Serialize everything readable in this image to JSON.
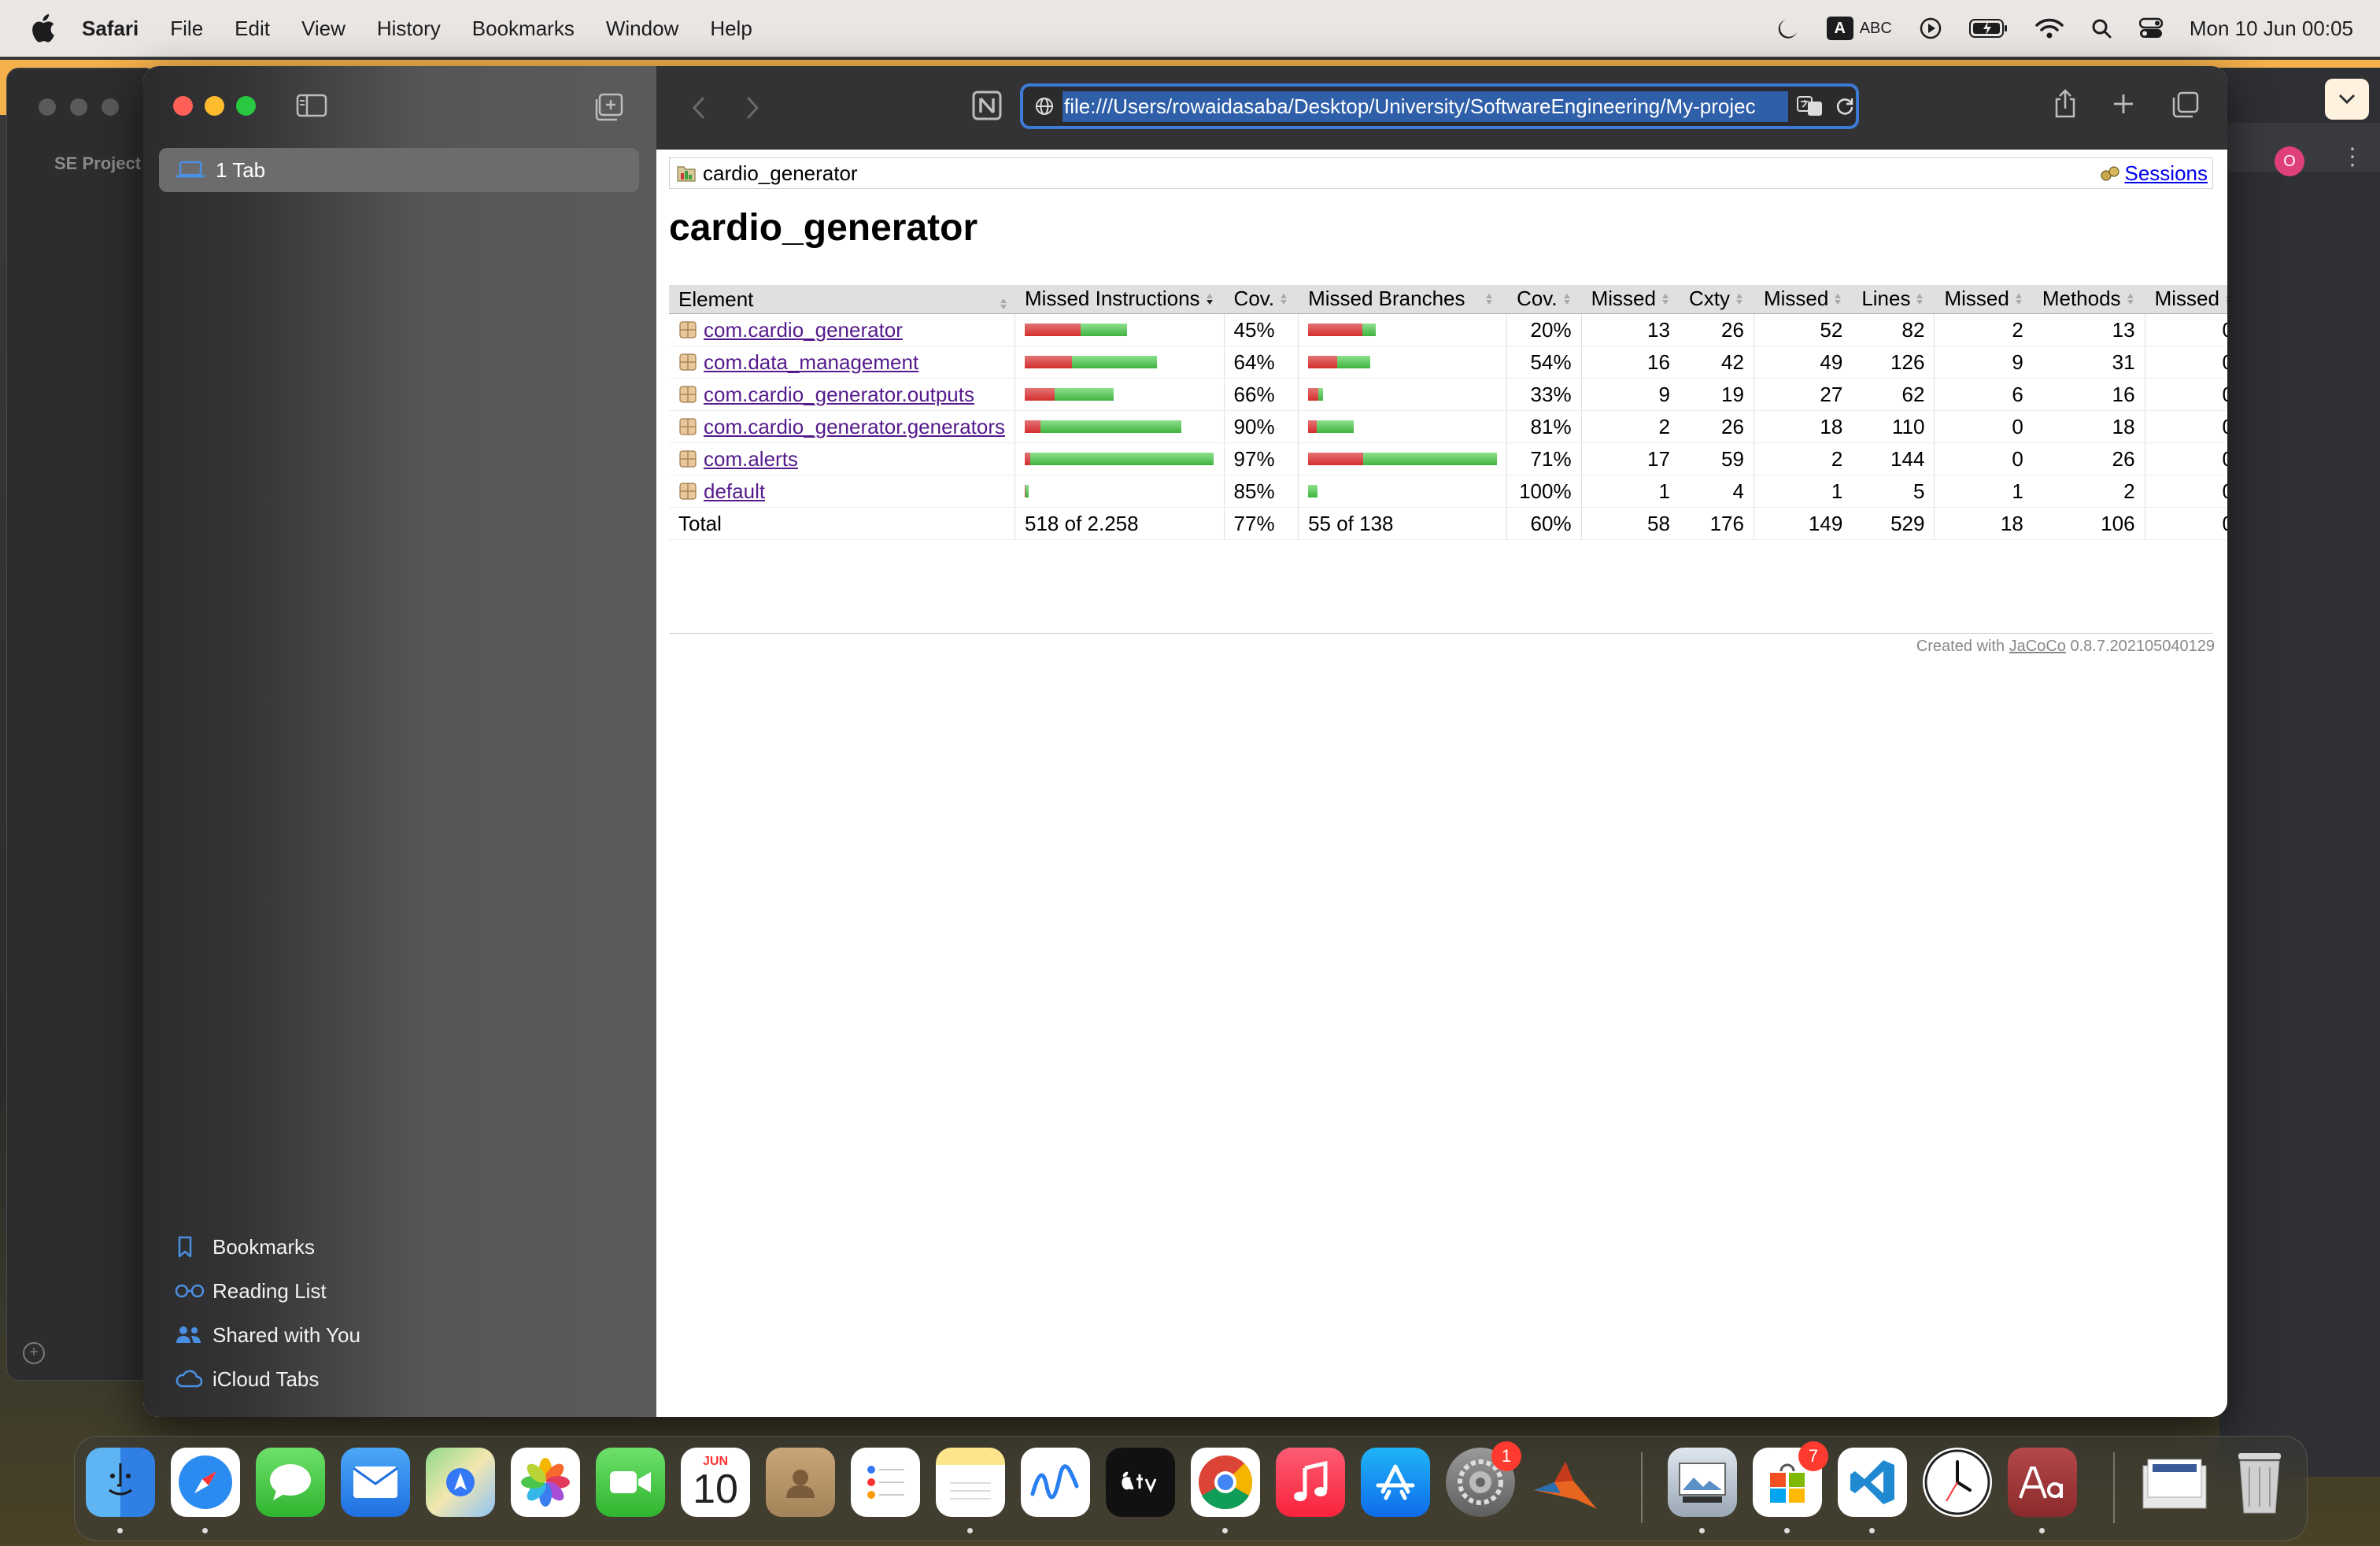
{
  "menubar": {
    "app_name": "Safari",
    "menus": [
      "File",
      "Edit",
      "View",
      "History",
      "Bookmarks",
      "Window",
      "Help"
    ],
    "input_source": "ABC",
    "input_source_letter": "A",
    "clock": "Mon 10 Jun  00:05"
  },
  "background_window": {
    "tab_title": "SE Project",
    "badge_text": "O"
  },
  "sidebar": {
    "tab_group_label": "1 Tab",
    "bottom_items": [
      {
        "label": "Bookmarks",
        "icon": "bookmark-icon"
      },
      {
        "label": "Reading List",
        "icon": "reading-list-icon"
      },
      {
        "label": "Shared with You",
        "icon": "shared-with-you-icon"
      },
      {
        "label": "iCloud Tabs",
        "icon": "icloud-icon"
      }
    ]
  },
  "toolbar": {
    "url": "file:///Users/rowaidasaba/Desktop/University/SoftwareEngineering/My-projec"
  },
  "page": {
    "breadcrumb": "cardio_generator",
    "sessions_link": "Sessions",
    "title": "cardio_generator",
    "columns": [
      "Element",
      "Missed Instructions",
      "Cov.",
      "Missed Branches",
      "Cov.",
      "Missed",
      "Cxty",
      "Missed",
      "Lines",
      "Missed",
      "Methods",
      "Missed"
    ],
    "rows": [
      {
        "name": "com.cardio_generator",
        "instr_cov": "45%",
        "instr_red": 0.55,
        "instr_green": 0.45,
        "instr_len": 0.54,
        "br_cov": "20%",
        "br_red": 0.8,
        "br_green": 0.2,
        "br_len": 0.36,
        "missed_cxty": "13",
        "cxty": "26",
        "missed_lines": "52",
        "lines": "82",
        "missed_methods": "2",
        "methods": "13",
        "missed_classes": "0"
      },
      {
        "name": "com.data_management",
        "instr_cov": "64%",
        "instr_red": 0.36,
        "instr_green": 0.64,
        "instr_len": 0.7,
        "br_cov": "54%",
        "br_red": 0.46,
        "br_green": 0.54,
        "br_len": 0.33,
        "missed_cxty": "16",
        "cxty": "42",
        "missed_lines": "49",
        "lines": "126",
        "missed_methods": "9",
        "methods": "31",
        "missed_classes": "0"
      },
      {
        "name": "com.cardio_generator.outputs",
        "instr_cov": "66%",
        "instr_red": 0.34,
        "instr_green": 0.66,
        "instr_len": 0.47,
        "br_cov": "33%",
        "br_red": 0.67,
        "br_green": 0.33,
        "br_len": 0.08,
        "missed_cxty": "9",
        "cxty": "19",
        "missed_lines": "27",
        "lines": "62",
        "missed_methods": "6",
        "methods": "16",
        "missed_classes": "0"
      },
      {
        "name": "com.cardio_generator.generators",
        "instr_cov": "90%",
        "instr_red": 0.1,
        "instr_green": 0.9,
        "instr_len": 0.83,
        "br_cov": "81%",
        "br_red": 0.19,
        "br_green": 0.81,
        "br_len": 0.24,
        "missed_cxty": "2",
        "cxty": "26",
        "missed_lines": "18",
        "lines": "110",
        "missed_methods": "0",
        "methods": "18",
        "missed_classes": "0"
      },
      {
        "name": "com.alerts",
        "instr_cov": "97%",
        "instr_red": 0.03,
        "instr_green": 0.97,
        "instr_len": 1.0,
        "br_cov": "71%",
        "br_red": 0.29,
        "br_green": 0.71,
        "br_len": 1.0,
        "missed_cxty": "17",
        "cxty": "59",
        "missed_lines": "2",
        "lines": "144",
        "missed_methods": "0",
        "methods": "26",
        "missed_classes": "0"
      },
      {
        "name": "default",
        "instr_cov": "85%",
        "instr_red": 0.15,
        "instr_green": 0.85,
        "instr_len": 0.02,
        "br_cov": "100%",
        "br_red": 0.0,
        "br_green": 1.0,
        "br_len": 0.05,
        "missed_cxty": "1",
        "cxty": "4",
        "missed_lines": "1",
        "lines": "5",
        "missed_methods": "1",
        "methods": "2",
        "missed_classes": "0"
      }
    ],
    "total": {
      "label": "Total",
      "instr": "518 of 2.258",
      "instr_cov": "77%",
      "br": "55 of 138",
      "br_cov": "60%",
      "missed_cxty": "58",
      "cxty": "176",
      "missed_lines": "149",
      "lines": "529",
      "missed_methods": "18",
      "methods": "106",
      "missed_classes": "0"
    },
    "footer_prefix": "Created with",
    "footer_link": "JaCoCo",
    "footer_version": "0.8.7.202105040129"
  },
  "dock": {
    "apps": [
      "Finder",
      "Safari",
      "Messages",
      "Mail",
      "Maps",
      "Photos",
      "FaceTime",
      "Calendar",
      "Contacts",
      "Reminders",
      "Notes",
      "Freeform",
      "TV",
      "Chrome",
      "Music",
      "App Store",
      "System Settings",
      "MATLAB",
      "Preview",
      "Microsoft Store",
      "Visual Studio Code",
      "Clock",
      "Dictionary",
      "Downloads",
      "Trash"
    ],
    "calendar_month": "JUN",
    "calendar_day": "10",
    "settings_badge": "1",
    "store_badge": "7"
  }
}
